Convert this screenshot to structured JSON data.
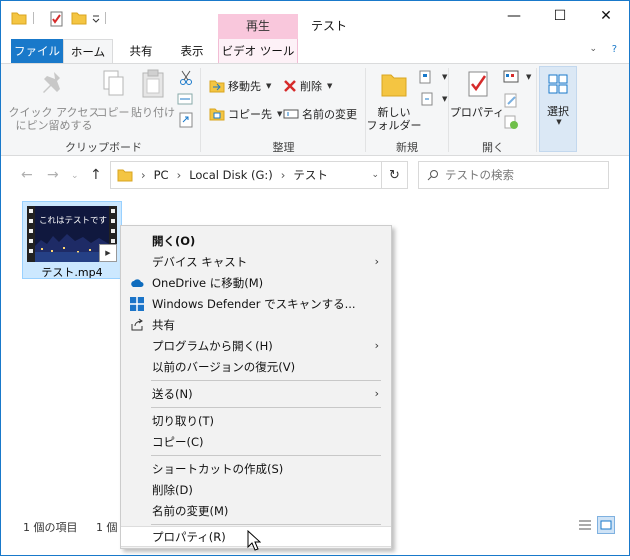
{
  "title_bar": {
    "context_tab_header": "再生",
    "title": "テスト",
    "minimize": "—",
    "maximize": "☐",
    "close": "✕"
  },
  "tabs": [
    {
      "label": "ファイル"
    },
    {
      "label": "ホーム"
    },
    {
      "label": "共有"
    },
    {
      "label": "表示"
    },
    {
      "label": "ビデオ ツール"
    }
  ],
  "ribbon": {
    "clipboard": {
      "pin_label_1": "クイック アクセス",
      "pin_label_2": "にピン留めする",
      "copy": "コピー",
      "paste": "貼り付け",
      "group": "クリップボード"
    },
    "organize": {
      "move_to": "移動先",
      "copy_to": "コピー先",
      "delete": "削除",
      "rename": "名前の変更",
      "group": "整理"
    },
    "new": {
      "new_folder_1": "新しい",
      "new_folder_2": "フォルダー",
      "group": "新規"
    },
    "open": {
      "properties": "プロパティ",
      "group": "開く"
    },
    "select": {
      "select": "選択"
    }
  },
  "address": {
    "crumbs": [
      "PC",
      "Local Disk (G:)",
      "テスト"
    ],
    "search_placeholder": "テストの検索"
  },
  "file": {
    "name": "テスト.mp4",
    "thumb_text": "これはテストです"
  },
  "status": {
    "count": "1 個の項目",
    "selected": "1 個"
  },
  "menu": {
    "items": [
      {
        "label": "開く(O)"
      },
      {
        "label": "デバイス キャスト"
      },
      {
        "label": "OneDrive に移動(M)"
      },
      {
        "label": "Windows Defender でスキャンする..."
      },
      {
        "label": "共有"
      },
      {
        "label": "プログラムから開く(H)"
      },
      {
        "label": "以前のバージョンの復元(V)"
      },
      {
        "label": "送る(N)"
      },
      {
        "label": "切り取り(T)"
      },
      {
        "label": "コピー(C)"
      },
      {
        "label": "ショートカットの作成(S)"
      },
      {
        "label": "削除(D)"
      },
      {
        "label": "名前の変更(M)"
      },
      {
        "label": "プロパティ(R)"
      }
    ]
  },
  "colors": {
    "accent": "#1979ca",
    "context_tab": "#f9c7dc",
    "selection": "#cce8ff"
  }
}
